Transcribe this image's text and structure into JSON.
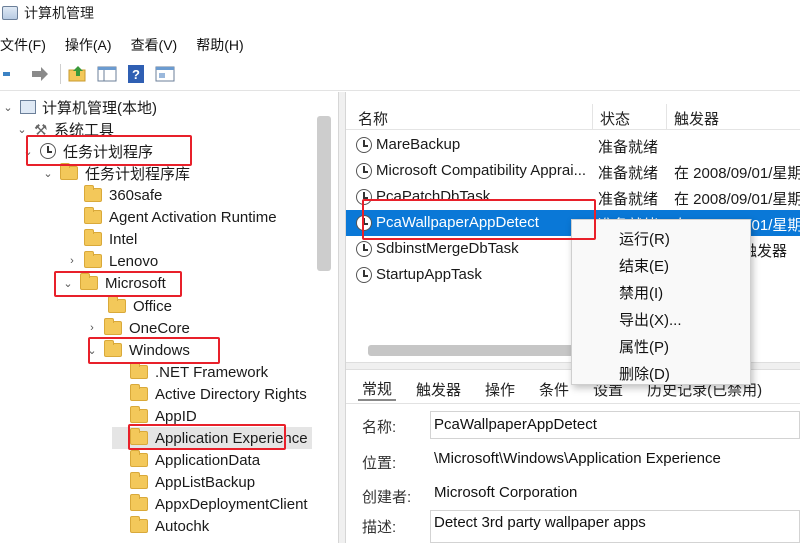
{
  "window": {
    "title": "计算机管理"
  },
  "menu": [
    "文件(F)",
    "操作(A)",
    "查看(V)",
    "帮助(H)"
  ],
  "toolbar": {
    "icons": [
      "back-arrow-icon",
      "forward-arrow-icon",
      "up-folder-icon",
      "show-hide-tree-icon",
      "help-icon",
      "properties-icon"
    ]
  },
  "tree": {
    "root": "计算机管理(本地)",
    "system_tools": "系统工具",
    "task_scheduler": "任务计划程序",
    "library": "任务计划程序库",
    "folders_level1": [
      "360safe",
      "Agent Activation Runtime",
      "Intel",
      "Lenovo",
      "Microsoft"
    ],
    "folders_level2": [
      "Office",
      "OneCore",
      "Windows"
    ],
    "folders_level3": [
      ".NET Framework",
      "Active Directory Rights",
      "AppID",
      "Application Experience",
      "ApplicationData",
      "AppListBackup",
      "AppxDeploymentClient",
      "Autochk"
    ]
  },
  "task_list": {
    "columns": [
      "名称",
      "状态",
      "触发器"
    ],
    "rows": [
      {
        "name": "MareBackup",
        "status": "准备就绪",
        "trigger": ""
      },
      {
        "name": "Microsoft Compatibility Apprai...",
        "status": "准备就绪",
        "trigger": "在 2008/09/01/星期"
      },
      {
        "name": "PcaPatchDbTask",
        "status": "准备就绪",
        "trigger": "在 2008/09/01/星期"
      },
      {
        "name": "PcaWallpaperAppDetect",
        "status": "准备就绪",
        "trigger": "在 2008/09/01/星期"
      },
      {
        "name": "SdbinstMergeDbTask",
        "status": "",
        "trigger": "触发器"
      },
      {
        "name": "StartupAppTask",
        "status": "",
        "trigger": ""
      }
    ]
  },
  "context_menu": [
    "运行(R)",
    "结束(E)",
    "禁用(I)",
    "导出(X)...",
    "属性(P)",
    "删除(D)"
  ],
  "details": {
    "tabs": [
      "常规",
      "触发器",
      "操作",
      "条件",
      "设置",
      "历史记录(已禁用)"
    ],
    "fields": [
      {
        "label": "名称:",
        "value": "PcaWallpaperAppDetect"
      },
      {
        "label": "位置:",
        "value": "\\Microsoft\\Windows\\Application Experience"
      },
      {
        "label": "创建者:",
        "value": "Microsoft Corporation"
      },
      {
        "label": "描述:",
        "value": "Detect 3rd party wallpaper apps"
      }
    ]
  },
  "colors": {
    "highlight": "#e8202a",
    "selection": "#0a78d7"
  }
}
